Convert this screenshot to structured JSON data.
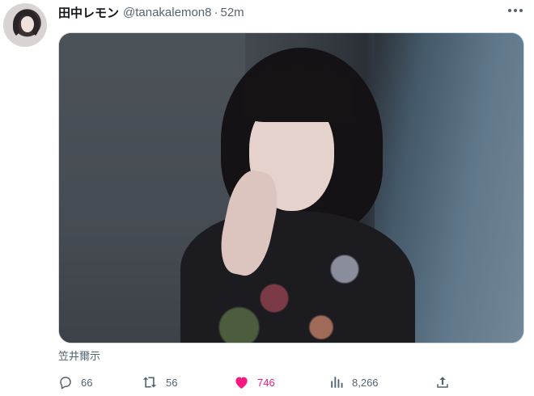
{
  "tweet": {
    "display_name": "田中レモン",
    "handle": "@tanakalemon8",
    "separator": "·",
    "time": "52m",
    "caption": "笠井爾示"
  },
  "actions": {
    "replies": "66",
    "retweets": "56",
    "likes": "746",
    "views": "8,266"
  },
  "icons": {
    "more": "more-horizontal-icon",
    "reply": "reply-icon",
    "retweet": "retweet-icon",
    "like": "heart-filled-icon",
    "views": "views-chart-icon",
    "share": "share-icon"
  },
  "colors": {
    "like_active": "#f91880",
    "muted_text": "#536471",
    "primary_text": "#0f1419"
  }
}
